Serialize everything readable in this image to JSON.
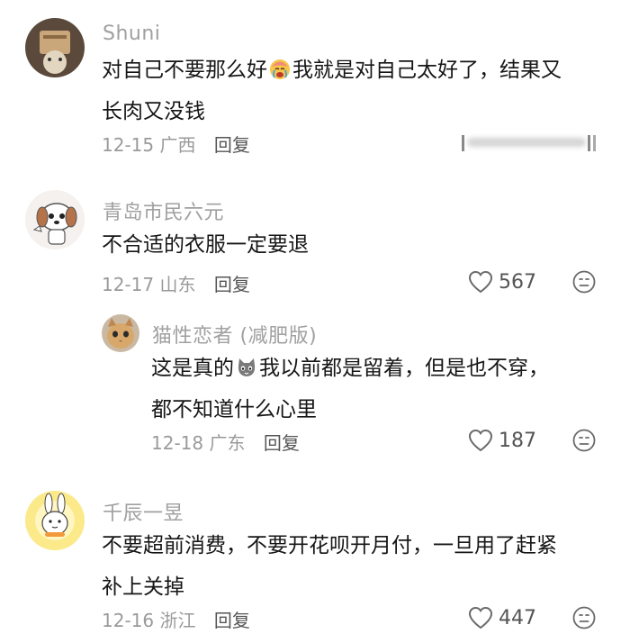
{
  "comments": [
    {
      "username": "Shuni",
      "line1_a": "对自己不要那么好",
      "line1_b": "我就是对自己太好了，结果又",
      "line2": "长肉又没钱",
      "date": "12-15",
      "location": "广西",
      "reply_label": "回复"
    },
    {
      "username": "青岛市民六元",
      "line1": "不合适的衣服一定要退",
      "date": "12-17",
      "location": "山东",
      "reply_label": "回复",
      "likes": "567",
      "replies": [
        {
          "username": "猫性恋者 (减肥版)",
          "line1_a": "这是真的",
          "line1_b": "我以前都是留着，但是也不穿，",
          "line2": "都不知道什么心里",
          "date": "12-18",
          "location": "广东",
          "reply_label": "回复",
          "likes": "187"
        }
      ]
    },
    {
      "username": "千辰一昱",
      "line1": "不要超前消费，不要开花呗开月付，一旦用了赶紧",
      "line2": "补上关掉",
      "date": "12-16",
      "location": "浙江",
      "reply_label": "回复",
      "likes": "447"
    }
  ],
  "icons": {
    "like": "heart-outline-icon",
    "dislike": "unhappy-face-icon",
    "emoji_1": "crying-face-emoji",
    "emoji_2": "cat-face-emoji"
  },
  "colors": {
    "username": "#a0a0a0",
    "content": "#161616",
    "meta": "#9a9a9a",
    "icon": "#6a6a6a"
  }
}
